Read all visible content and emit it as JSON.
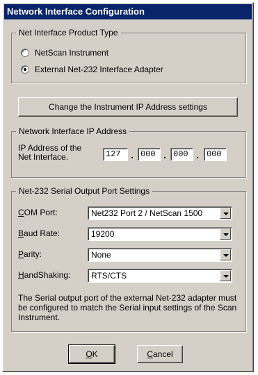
{
  "window": {
    "title": "Network Interface Configuration"
  },
  "product_type": {
    "legend": "Net Interface Product Type",
    "options": [
      {
        "label": "NetScan Instrument",
        "checked": false
      },
      {
        "label": "External Net-232  Interface Adapter",
        "checked": true
      }
    ]
  },
  "change_ip_button": {
    "label": "Change the Instrument IP Address settings"
  },
  "ip_group": {
    "legend": "Network Interface IP Address",
    "label_line1": "IP Address of the",
    "label_line2": "Net Interface.",
    "octets": [
      "127",
      "000",
      "000",
      "000"
    ]
  },
  "serial_group": {
    "legend": "Net-232 Serial Output Port Settings",
    "com_port": {
      "label_key": "C",
      "label_rest": "OM Port:",
      "value": "Net232 Port 2 / NetScan 1500"
    },
    "baud_rate": {
      "label_key": "B",
      "label_rest": "aud Rate:",
      "value": "19200"
    },
    "parity": {
      "label_key": "P",
      "label_rest": "arity:",
      "value": "None"
    },
    "handshaking": {
      "label_key": "H",
      "label_rest": "andShaking:",
      "value": "RTS/CTS"
    },
    "note": "The Serial output port of the external Net-232 adapter must be configured to match the Serial input settings of the Scan Instrument."
  },
  "buttons": {
    "ok_key": "O",
    "ok_rest": "K",
    "cancel_key": "C",
    "cancel_rest": "ancel"
  }
}
